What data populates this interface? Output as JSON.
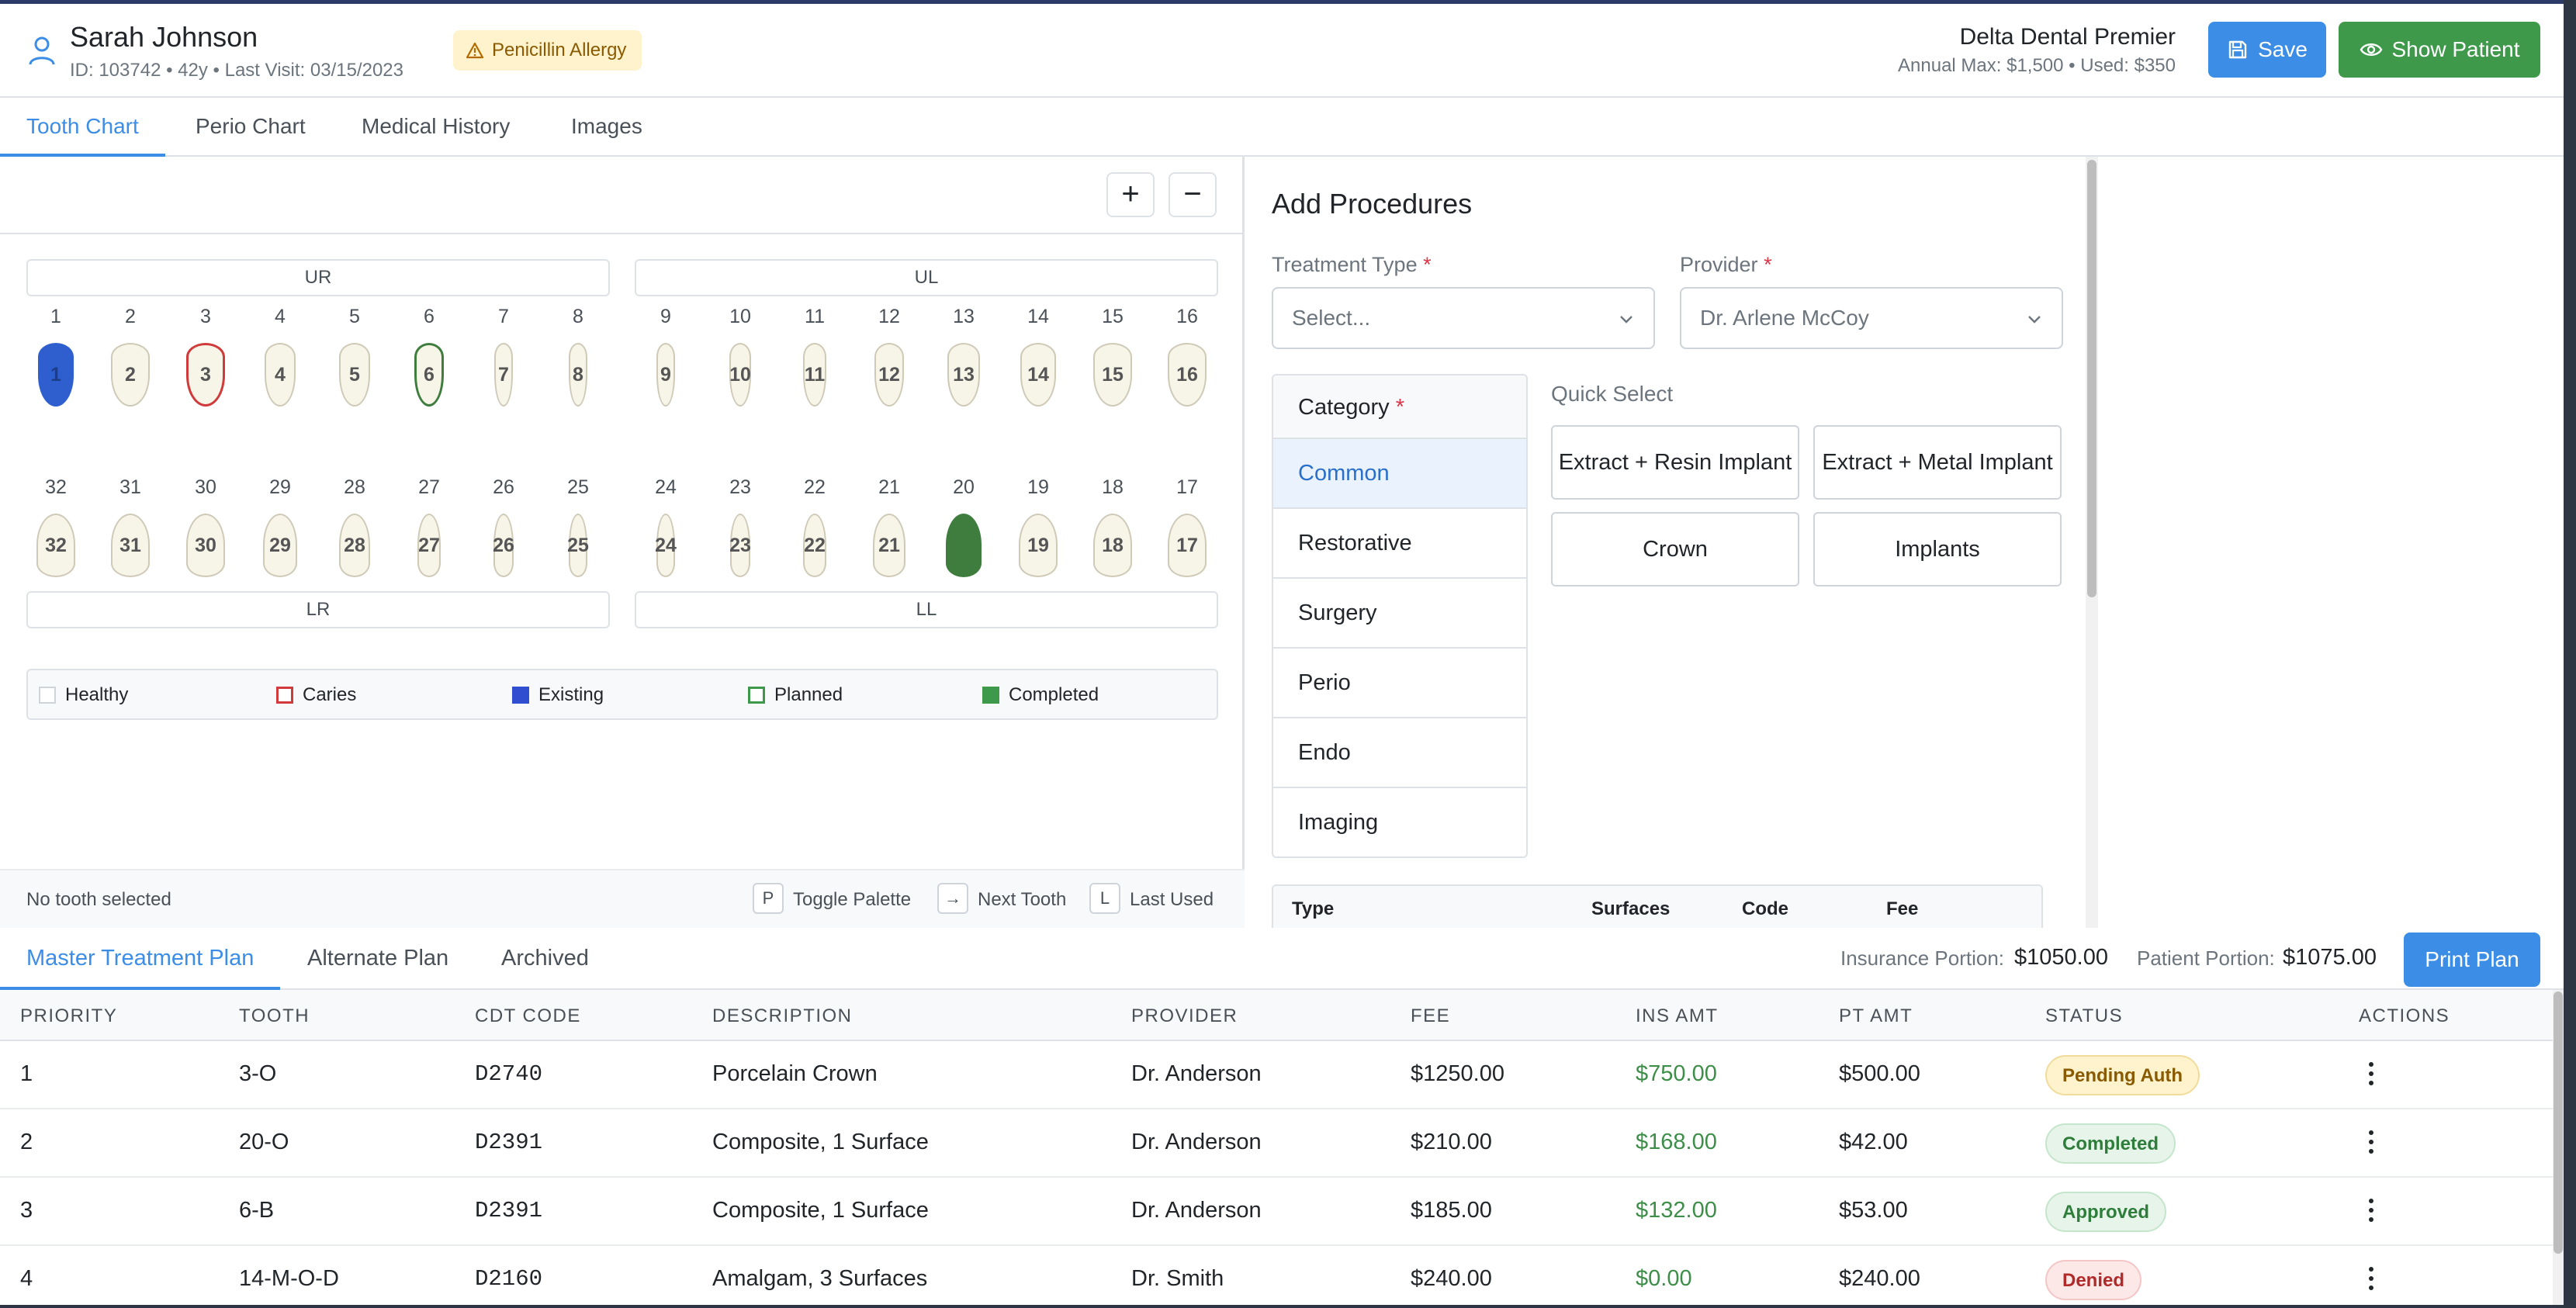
{
  "patient": {
    "name": "Sarah Johnson",
    "meta": "ID: 103742 • 42y • Last Visit: 03/15/2023",
    "allergy": "Penicillin Allergy"
  },
  "insurance": {
    "name": "Delta Dental Premier",
    "details": "Annual Max: $1,500 • Used: $350"
  },
  "header_buttons": {
    "save": "Save",
    "show_patient": "Show Patient"
  },
  "top_tabs": [
    "Tooth Chart",
    "Perio Chart",
    "Medical History",
    "Images"
  ],
  "active_top_tab": "Tooth Chart",
  "zoom": {
    "in": "+",
    "out": "−"
  },
  "quadrants": {
    "ur": "UR",
    "ul": "UL",
    "lr": "LR",
    "ll": "LL"
  },
  "upper_teeth": [
    {
      "num": "1",
      "state": "existing"
    },
    {
      "num": "2",
      "state": "healthy"
    },
    {
      "num": "3",
      "state": "caries"
    },
    {
      "num": "4",
      "state": "healthy"
    },
    {
      "num": "5",
      "state": "healthy"
    },
    {
      "num": "6",
      "state": "planned"
    },
    {
      "num": "7",
      "state": "healthy"
    },
    {
      "num": "8",
      "state": "healthy"
    },
    {
      "num": "9",
      "state": "healthy"
    },
    {
      "num": "10",
      "state": "healthy"
    },
    {
      "num": "11",
      "state": "healthy"
    },
    {
      "num": "12",
      "state": "healthy"
    },
    {
      "num": "13",
      "state": "healthy"
    },
    {
      "num": "14",
      "state": "healthy"
    },
    {
      "num": "15",
      "state": "healthy"
    },
    {
      "num": "16",
      "state": "healthy"
    }
  ],
  "lower_teeth": [
    {
      "num": "32",
      "state": "healthy"
    },
    {
      "num": "31",
      "state": "healthy"
    },
    {
      "num": "30",
      "state": "healthy"
    },
    {
      "num": "29",
      "state": "healthy"
    },
    {
      "num": "28",
      "state": "healthy"
    },
    {
      "num": "27",
      "state": "healthy"
    },
    {
      "num": "26",
      "state": "healthy"
    },
    {
      "num": "25",
      "state": "healthy"
    },
    {
      "num": "24",
      "state": "healthy"
    },
    {
      "num": "23",
      "state": "healthy"
    },
    {
      "num": "22",
      "state": "healthy"
    },
    {
      "num": "21",
      "state": "healthy"
    },
    {
      "num": "20",
      "state": "completed"
    },
    {
      "num": "19",
      "state": "healthy"
    },
    {
      "num": "18",
      "state": "healthy"
    },
    {
      "num": "17",
      "state": "healthy"
    }
  ],
  "legend": {
    "healthy": "Healthy",
    "caries": "Caries",
    "existing": "Existing",
    "planned": "Planned",
    "completed": "Completed"
  },
  "colors": {
    "existing": "#2f5fcf",
    "caries": "#d03a3a",
    "planned": "#3e7d3e",
    "completed": "#3e7d3e",
    "accent": "#3b8de6",
    "success": "#3e9a4a"
  },
  "chart_footer": {
    "selection": "No tooth selected",
    "shortcuts": [
      {
        "key": "P",
        "label": "Toggle Palette"
      },
      {
        "key": "→",
        "label": "Next Tooth"
      },
      {
        "key": "L",
        "label": "Last Used"
      }
    ]
  },
  "procedures": {
    "title": "Add Procedures",
    "treatment_type_label": "Treatment Type",
    "treatment_type_value": "Select...",
    "provider_label": "Provider",
    "provider_value": "Dr. Arlene McCoy",
    "required_mark": "*",
    "category_label": "Category",
    "categories": [
      "Common",
      "Restorative",
      "Surgery",
      "Perio",
      "Endo",
      "Imaging"
    ],
    "active_category": "Common",
    "quick_select_label": "Quick Select",
    "quick_select": [
      "Extract + Resin Implant",
      "Extract + Metal Implant",
      "Crown",
      "Implants"
    ],
    "table_headers": [
      "Type",
      "Surfaces",
      "Code",
      "Fee"
    ]
  },
  "plan_tabs": [
    "Master Treatment Plan",
    "Alternate Plan",
    "Archived"
  ],
  "active_plan_tab": "Master Treatment Plan",
  "portions": {
    "insurance_label": "Insurance Portion:",
    "insurance_value": "$1050.00",
    "patient_label": "Patient Portion:",
    "patient_value": "$1075.00"
  },
  "print_plan": "Print Plan",
  "plan_headers": [
    "PRIORITY",
    "TOOTH",
    "CDT CODE",
    "DESCRIPTION",
    "PROVIDER",
    "FEE",
    "INS AMT",
    "PT AMT",
    "STATUS",
    "ACTIONS"
  ],
  "plan_rows": [
    {
      "priority": "1",
      "tooth": "3-O",
      "code": "D2740",
      "description": "Porcelain Crown",
      "provider": "Dr. Anderson",
      "fee": "$1250.00",
      "ins": "$750.00",
      "pt": "$500.00",
      "status": "Pending Auth"
    },
    {
      "priority": "2",
      "tooth": "20-O",
      "code": "D2391",
      "description": "Composite, 1 Surface",
      "provider": "Dr. Anderson",
      "fee": "$210.00",
      "ins": "$168.00",
      "pt": "$42.00",
      "status": "Completed"
    },
    {
      "priority": "3",
      "tooth": "6-B",
      "code": "D2391",
      "description": "Composite, 1 Surface",
      "provider": "Dr. Anderson",
      "fee": "$185.00",
      "ins": "$132.00",
      "pt": "$53.00",
      "status": "Approved"
    },
    {
      "priority": "4",
      "tooth": "14-M-O-D",
      "code": "D2160",
      "description": "Amalgam, 3 Surfaces",
      "provider": "Dr. Smith",
      "fee": "$240.00",
      "ins": "$0.00",
      "pt": "$240.00",
      "status": "Denied"
    }
  ],
  "status_styles": {
    "Pending Auth": {
      "bg": "#fff3cd",
      "fg": "#8a5a00",
      "border": "#f1dc9b"
    },
    "Completed": {
      "bg": "#e6f4ea",
      "fg": "#2e7d3a",
      "border": "#c5e5cc"
    },
    "Approved": {
      "bg": "#e6f4ea",
      "fg": "#2e7d3a",
      "border": "#c5e5cc"
    },
    "Denied": {
      "bg": "#fde8e8",
      "fg": "#b02a2a",
      "border": "#f5c6c6"
    }
  }
}
